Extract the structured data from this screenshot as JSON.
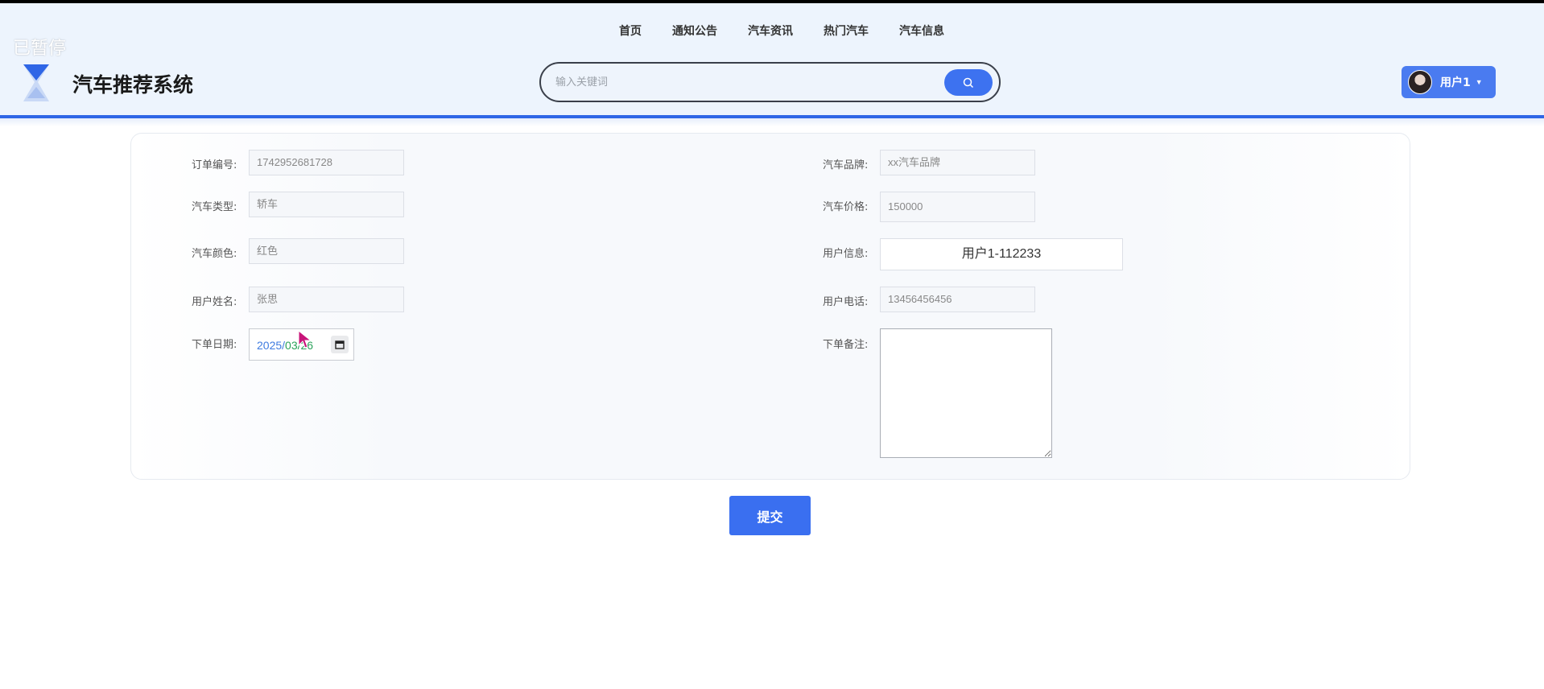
{
  "overlay": {
    "paused_text": "已暂停"
  },
  "brand": {
    "title": "汽车推荐系统"
  },
  "nav": {
    "items": [
      "首页",
      "通知公告",
      "汽车资讯",
      "热门汽车",
      "汽车信息"
    ]
  },
  "search": {
    "placeholder": "输入关键词",
    "value": ""
  },
  "user": {
    "name": "用户1"
  },
  "form": {
    "order_no_label": "订单编号:",
    "order_no_value": "1742952681728",
    "brand_label": "汽车品牌:",
    "brand_value": "xx汽车品牌",
    "type_label": "汽车类型:",
    "type_value": "轿车",
    "price_label": "汽车价格:",
    "price_value": "150000",
    "color_label": "汽车颜色:",
    "color_value": "红色",
    "userinfo_label": "用户信息:",
    "userinfo_value": "用户1-112233",
    "username_label": "用户姓名:",
    "username_value": "张思",
    "phone_label": "用户电话:",
    "phone_value": "13456456456",
    "date_label": "下单日期:",
    "date_year": "2025/",
    "date_md": "03/26",
    "remark_label": "下单备注:",
    "remark_value": ""
  },
  "actions": {
    "submit_label": "提交"
  },
  "colors": {
    "accent": "#3a6ff0",
    "header_bg": "#edf4fd",
    "header_line": "#2f66e6"
  }
}
